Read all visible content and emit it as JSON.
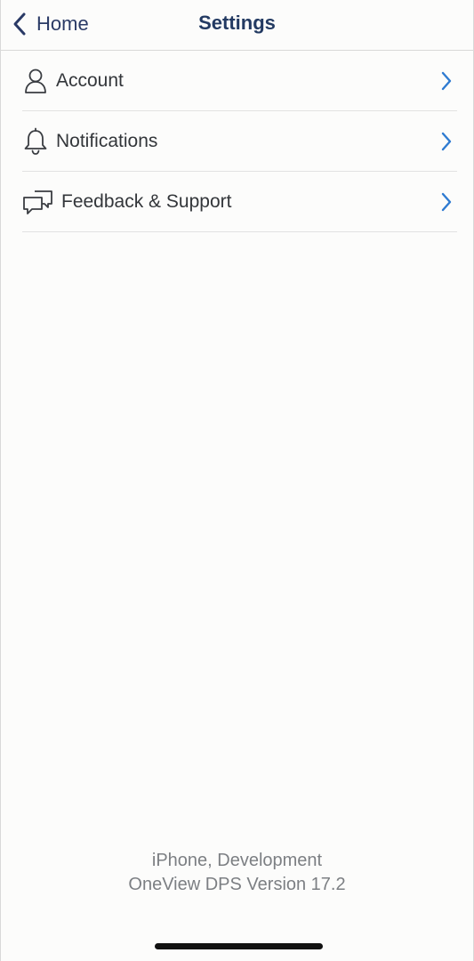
{
  "nav": {
    "back_label": "Home",
    "title": "Settings"
  },
  "settings": {
    "items": [
      {
        "label": "Account",
        "icon": "person-icon"
      },
      {
        "label": "Notifications",
        "icon": "bell-icon"
      },
      {
        "label": "Feedback & Support",
        "icon": "chat-bubbles-icon"
      }
    ]
  },
  "footer": {
    "device_line": "iPhone, Development",
    "version_line": "OneView DPS Version 17.2"
  },
  "colors": {
    "accent_blue": "#2f7bd1",
    "nav_title": "#233a62",
    "background": "#fcfcfb"
  }
}
